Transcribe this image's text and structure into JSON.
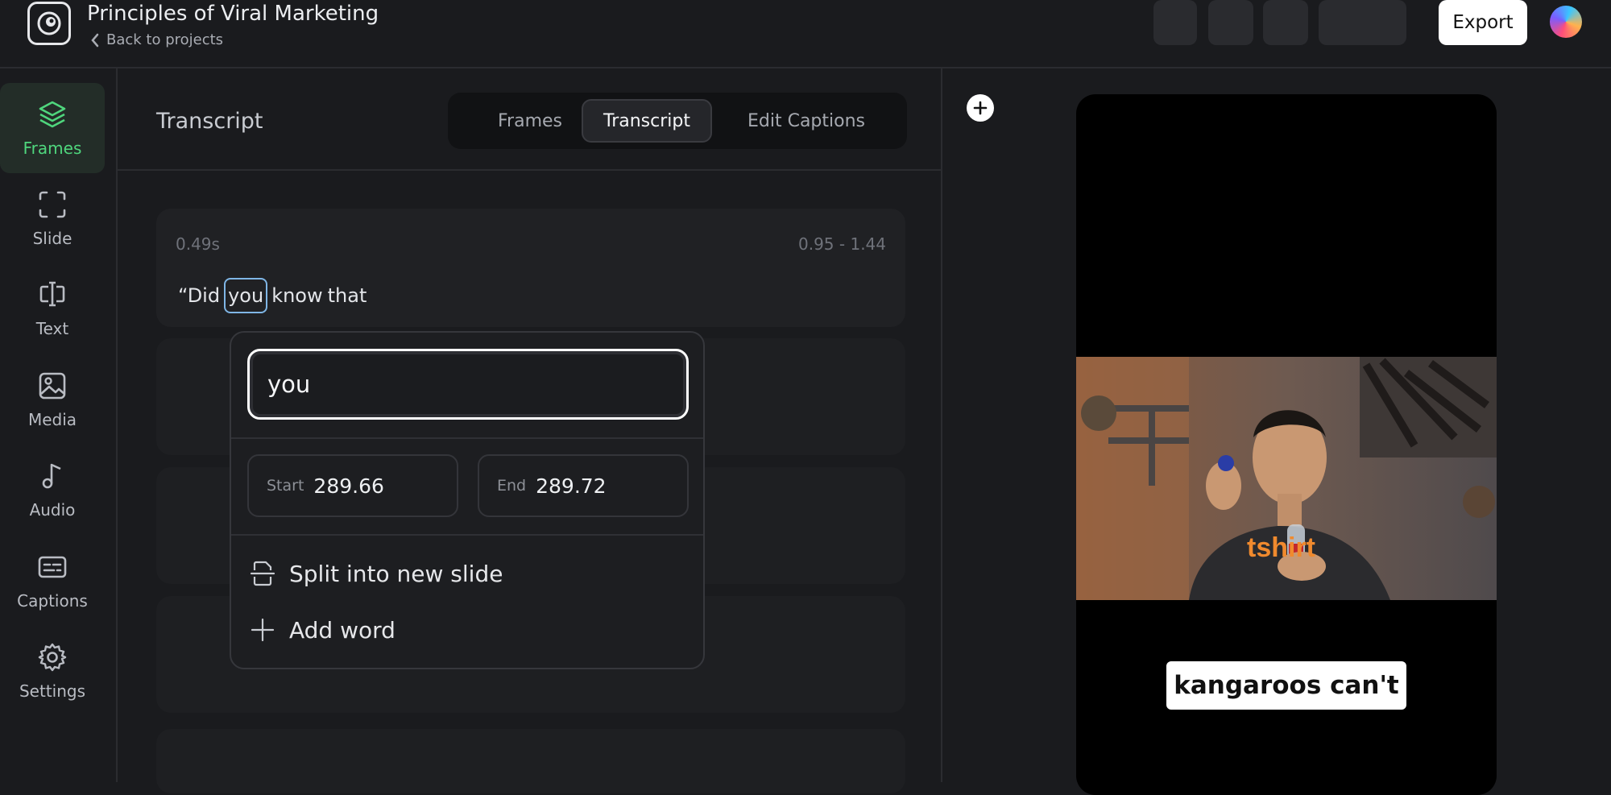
{
  "header": {
    "title": "Principles of Viral Marketing",
    "back_label": "Back to projects",
    "export_label": "Export"
  },
  "sidebar": {
    "items": [
      {
        "label": "Frames",
        "icon": "layers-icon",
        "active": true
      },
      {
        "label": "Slide",
        "icon": "frame-corners-icon"
      },
      {
        "label": "Text",
        "icon": "text-cursor-icon"
      },
      {
        "label": "Media",
        "icon": "image-icon"
      },
      {
        "label": "Audio",
        "icon": "music-note-icon"
      },
      {
        "label": "Captions",
        "icon": "captions-icon"
      },
      {
        "label": "Settings",
        "icon": "gear-icon"
      }
    ]
  },
  "panel": {
    "title": "Transcript",
    "tabs": [
      {
        "label": "Frames"
      },
      {
        "label": "Transcript",
        "active": true
      },
      {
        "label": "Edit Captions"
      }
    ]
  },
  "segment": {
    "duration": "0.49s",
    "range": "0.95 - 1.44",
    "words": [
      "“Did",
      "you",
      "know",
      "that"
    ],
    "selected_word_index": 1
  },
  "popover": {
    "word_value": "you",
    "start_label": "Start",
    "start_value": "289.66",
    "end_label": "End",
    "end_value": "289.72",
    "split_label": "Split into new slide",
    "add_word_label": "Add word"
  },
  "preview": {
    "caption": "kangaroos can't",
    "shirt_text": "tshirt"
  },
  "colors": {
    "accent_green": "#4fd67d",
    "selection_blue": "#7fb6e6",
    "background": "#1a1b1e"
  }
}
